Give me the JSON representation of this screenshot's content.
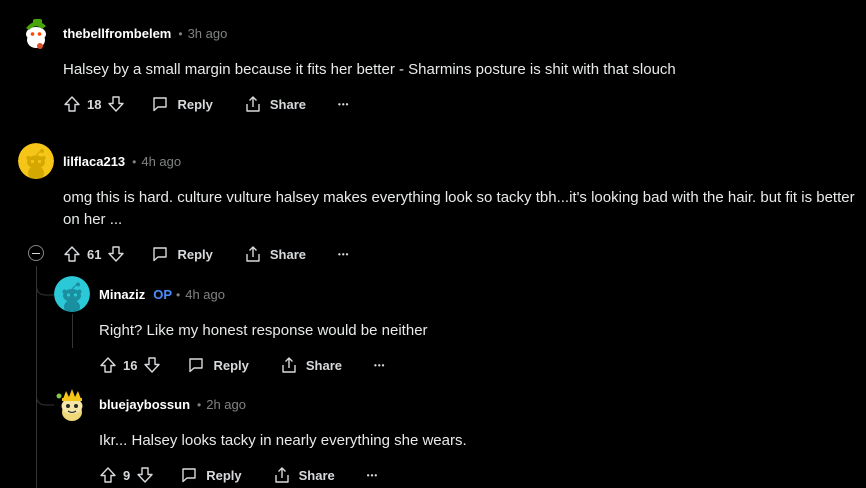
{
  "comments": [
    {
      "username": "thebellfrombelem",
      "time": "3h ago",
      "text": "Halsey by a small margin because it fits her better - Sharmins posture is shit with that slouch",
      "votes": "18",
      "avatar_icon": "snoo-avatar-green-icon"
    },
    {
      "username": "lilflaca213",
      "time": "4h ago",
      "text": "omg this is hard. culture vulture halsey makes everything look so tacky tbh...it's looking bad with the hair. but fit is better on her ...",
      "votes": "61",
      "avatar_icon": "snoo-avatar-yellow-icon"
    },
    {
      "username": "Minaziz",
      "op_badge": "OP",
      "time": "4h ago",
      "text": "Right? Like my honest response would be neither",
      "votes": "16",
      "avatar_icon": "snoo-avatar-teal-icon"
    },
    {
      "username": "bluejaybossun",
      "time": "2h ago",
      "text": "Ikr... Halsey looks tacky in nearly everything she wears.",
      "votes": "9",
      "avatar_icon": "snoo-avatar-yellow-hat-icon"
    }
  ],
  "actions": {
    "reply_label": "Reply",
    "share_label": "Share",
    "more_label": "•••",
    "dot": "•"
  },
  "colors": {
    "background": "#000000",
    "text": "#d7dadc",
    "muted": "#818384",
    "op_blue": "#4b8cff",
    "thread_line": "#343536"
  }
}
